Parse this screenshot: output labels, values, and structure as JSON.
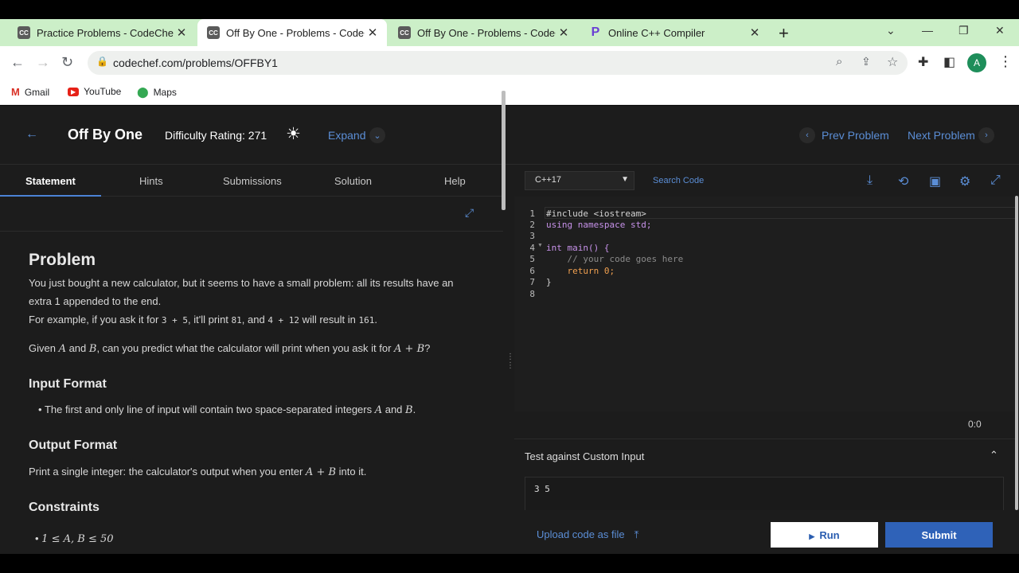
{
  "browser": {
    "tabs": [
      {
        "title": "Practice Problems - CodeChef",
        "favicon": "cc"
      },
      {
        "title": "Off By One - Problems - CodeChef",
        "favicon": "cc"
      },
      {
        "title": "Off By One - Problems - CodeChef",
        "favicon": "cc"
      },
      {
        "title": "Online C++ Compiler",
        "favicon": "p"
      }
    ],
    "url": "codechef.com/problems/OFFBY1",
    "bookmarks": [
      "Gmail",
      "YouTube",
      "Maps"
    ],
    "profile_initial": "A"
  },
  "header": {
    "title": "Off By One",
    "difficulty": "Difficulty Rating: 271",
    "expand": "Expand",
    "prev": "Prev Problem",
    "next": "Next Problem"
  },
  "statement_tabs": [
    "Statement",
    "Hints",
    "Submissions",
    "Solution",
    "Help"
  ],
  "statement": {
    "problem_heading": "Problem",
    "p1": "You just bought a new calculator, but it seems to have a small problem: all its results have an extra 1 appended to the end.",
    "p2a": "For example, if you ask it for ",
    "p2_expr1": "3  +  5",
    "p2b": ", it'll print ",
    "p2_res1": "81",
    "p2c": ", and ",
    "p2_expr2": "4  +  12",
    "p2d": " will result in ",
    "p2_res2": "161",
    "p2e": ".",
    "p3a": "Given ",
    "p3_A": "A",
    "p3b": " and ",
    "p3_B": "B",
    "p3c": ", can you predict what the calculator will print when you ask it for ",
    "p3_expr": "A + B",
    "p3d": "?",
    "input_heading": "Input Format",
    "input_a": "The first and only line of input will contain two space-separated integers ",
    "input_A": "A",
    "input_b": " and ",
    "input_B": "B",
    "input_c": ".",
    "output_heading": "Output Format",
    "output_a": "Print a single integer: the calculator's output when you enter ",
    "output_expr": "A + B",
    "output_b": " into it.",
    "constraints_heading": "Constraints",
    "constraint1": "1 ≤ A, B ≤ 50"
  },
  "editor": {
    "language": "C++17",
    "search_placeholder": "Search Code",
    "line_numbers": [
      "1",
      "2",
      "3",
      "4",
      "5",
      "6",
      "7",
      "8"
    ],
    "lines": [
      "#include <iostream>",
      "using namespace std;",
      "",
      "int main() {",
      "    // your code goes here",
      "    return 0;",
      "}",
      ""
    ],
    "cursor": "0:0"
  },
  "custom_input": {
    "title": "Test against Custom Input",
    "value": "3 5"
  },
  "actions": {
    "upload": "Upload code as file",
    "run": "Run",
    "submit": "Submit"
  }
}
